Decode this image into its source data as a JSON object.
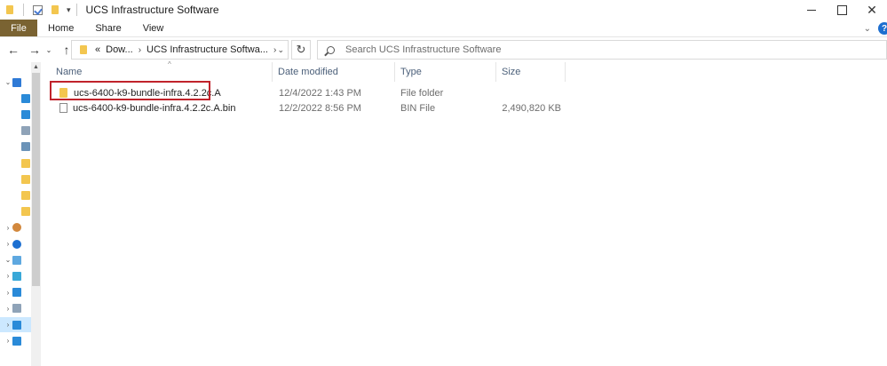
{
  "window": {
    "title": "UCS Infrastructure Software",
    "controls": {
      "minimize": "",
      "maximize": "",
      "close": "✕"
    }
  },
  "ribbon": {
    "tabs": [
      "File",
      "Home",
      "Share",
      "View"
    ],
    "help": "?"
  },
  "nav": {
    "back": "←",
    "forward": "→",
    "recent_dropdown": "⌄",
    "up": "↑",
    "address": {
      "overflow": "«",
      "parts": [
        "Dow...",
        "UCS Infrastructure Softwa..."
      ],
      "separator": "›"
    },
    "refresh": "↻"
  },
  "search": {
    "placeholder": "Search UCS Infrastructure Software"
  },
  "navpane": {
    "items": [
      {
        "chevron": "⌄",
        "icon": "quick-access-icon",
        "color": "#2f7ad6"
      },
      {
        "chevron": "",
        "icon": "desktop-icon",
        "color": "#2a8ad8"
      },
      {
        "chevron": "",
        "icon": "downloads-icon",
        "color": "#2a8ad8"
      },
      {
        "chevron": "",
        "icon": "documents-icon",
        "color": "#8fa3b8"
      },
      {
        "chevron": "",
        "icon": "pictures-icon",
        "color": "#6b93b8"
      },
      {
        "chevron": "",
        "icon": "folder-icon",
        "color": "#f3c64f"
      },
      {
        "chevron": "",
        "icon": "folder-icon",
        "color": "#f3c64f"
      },
      {
        "chevron": "",
        "icon": "folder-icon",
        "color": "#f3c64f"
      },
      {
        "chevron": "",
        "icon": "folder-icon",
        "color": "#f3c64f"
      },
      {
        "chevron": "›",
        "icon": "user-folder-icon",
        "color": "#d2883d"
      },
      {
        "chevron": "›",
        "icon": "onedrive-icon",
        "color": "#1c6fd1"
      },
      {
        "chevron": "⌄",
        "icon": "this-pc-icon",
        "color": "#5ea8e0"
      },
      {
        "chevron": "›",
        "icon": "3d-objects-icon",
        "color": "#39a8d8"
      },
      {
        "chevron": "›",
        "icon": "desktop-icon",
        "color": "#2a8ad8"
      },
      {
        "chevron": "›",
        "icon": "documents-icon",
        "color": "#8fa3b8"
      },
      {
        "chevron": "›",
        "icon": "downloads-icon",
        "color": "#2a8ad8"
      },
      {
        "chevron": "›",
        "icon": "music-icon",
        "color": "#2a8ad8"
      }
    ]
  },
  "columns": {
    "name": "Name",
    "date": "Date modified",
    "type": "Type",
    "size": "Size"
  },
  "files": [
    {
      "name": "ucs-6400-k9-bundle-infra.4.2.2c.A",
      "date": "12/4/2022 1:43 PM",
      "type": "File folder",
      "size": "",
      "kind": "folder"
    },
    {
      "name": "ucs-6400-k9-bundle-infra.4.2.2c.A.bin",
      "date": "12/2/2022 8:56 PM",
      "type": "BIN File",
      "size": "2,490,820 KB",
      "kind": "file"
    }
  ],
  "colors": {
    "file_tab": "#7a6332",
    "highlight": "#c0232b",
    "selection": "#cce8ff",
    "header_text": "#4c607a"
  }
}
